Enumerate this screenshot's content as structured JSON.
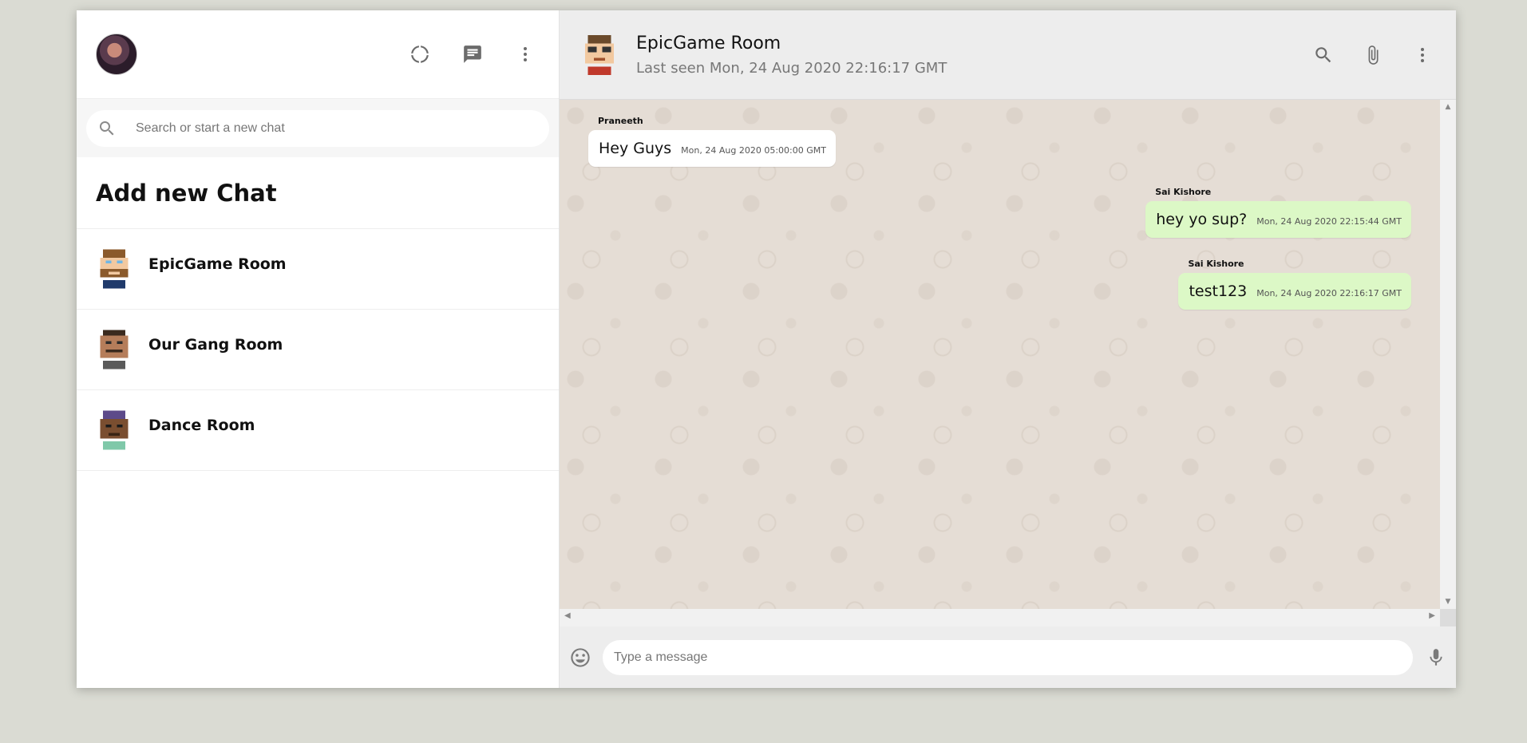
{
  "sidebar": {
    "search_placeholder": "Search or start a new chat",
    "add_new_chat": "Add new Chat",
    "rooms": [
      {
        "name": "EpicGame Room",
        "avatar": "avatar-pixel-beard"
      },
      {
        "name": "Our Gang Room",
        "avatar": "avatar-pixel-mustache"
      },
      {
        "name": "Dance Room",
        "avatar": "avatar-pixel-beanie"
      }
    ],
    "header_icons": [
      "status-icon",
      "new-chat-icon",
      "more-vert-icon"
    ]
  },
  "chat": {
    "title": "EpicGame Room",
    "last_seen": "Last seen Mon, 24 Aug 2020 22:16:17 GMT",
    "header_icons": [
      "search-icon",
      "attach-icon",
      "more-vert-icon"
    ],
    "messages": [
      {
        "author": "Praneeth",
        "text": "Hey Guys",
        "time": "Mon, 24 Aug 2020 05:00:00 GMT",
        "mine": false
      },
      {
        "author": "Sai Kishore",
        "text": "hey yo sup?",
        "time": "Mon, 24 Aug 2020 22:15:44 GMT",
        "mine": true
      },
      {
        "author": "Sai Kishore",
        "text": "test123",
        "time": "Mon, 24 Aug 2020 22:16:17 GMT",
        "mine": true
      }
    ],
    "input_placeholder": "Type a message"
  },
  "colors": {
    "page_bg": "#dadbd3",
    "outgoing_bubble": "#dcf8c6",
    "incoming_bubble": "#ffffff",
    "chat_bg": "#e5ddd5"
  }
}
